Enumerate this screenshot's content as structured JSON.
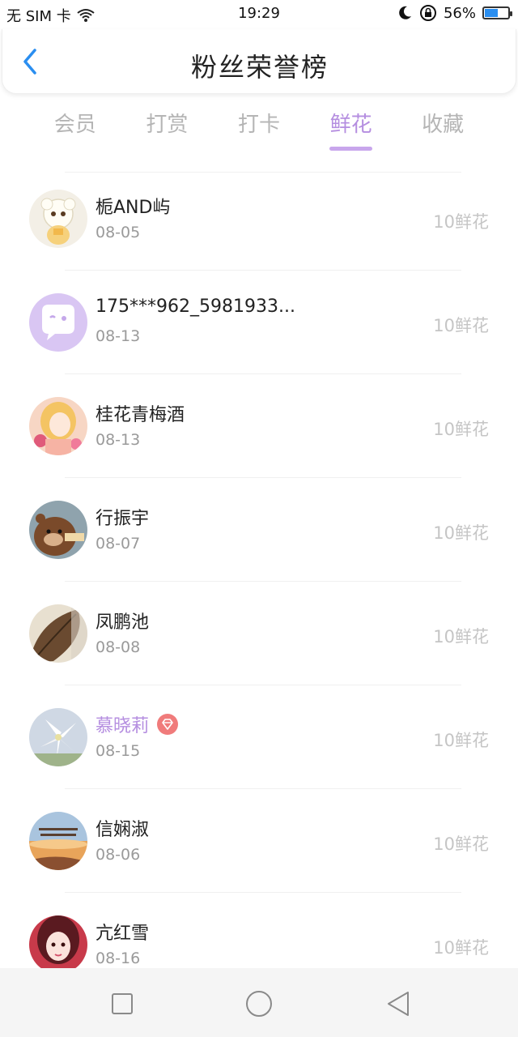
{
  "status": {
    "carrier": "无 SIM 卡",
    "time": "19:29",
    "battery_text": "56%",
    "battery_level": 0.56,
    "icons": [
      "wifi-icon",
      "moon-icon",
      "rotation-lock-icon",
      "battery-icon"
    ]
  },
  "header": {
    "title": "粉丝荣誉榜",
    "back_icon": "back-arrow-icon"
  },
  "tabs": [
    {
      "label": "会员",
      "active": false
    },
    {
      "label": "打赏",
      "active": false
    },
    {
      "label": "打卡",
      "active": false
    },
    {
      "label": "鲜花",
      "active": true
    },
    {
      "label": "收藏",
      "active": false
    }
  ],
  "fans": [
    {
      "name": "栀AND屿",
      "date": "08-05",
      "amount": "10鲜花",
      "vip": false,
      "avatar": "sheep-cartoon"
    },
    {
      "name": "175***962_5981933...",
      "date": "08-13",
      "amount": "10鲜花",
      "vip": false,
      "avatar": "default-chat-bubble"
    },
    {
      "name": "桂花青梅酒",
      "date": "08-13",
      "amount": "10鲜花",
      "vip": false,
      "avatar": "anime-girl"
    },
    {
      "name": "行振宇",
      "date": "08-07",
      "amount": "10鲜花",
      "vip": false,
      "avatar": "bear-cartoon"
    },
    {
      "name": "凤鹏池",
      "date": "08-08",
      "amount": "10鲜花",
      "vip": false,
      "avatar": "leaf-photo"
    },
    {
      "name": "慕晓莉",
      "date": "08-15",
      "amount": "10鲜花",
      "vip": true,
      "avatar": "lily-photo"
    },
    {
      "name": "信娴淑",
      "date": "08-06",
      "amount": "10鲜花",
      "vip": false,
      "avatar": "sunset-text-photo"
    },
    {
      "name": "亢红雪",
      "date": "08-16",
      "amount": "10鲜花",
      "vip": false,
      "avatar": "girl-photo"
    }
  ],
  "colors": {
    "accent": "#b58ee0",
    "tab_inactive": "#b5b5b5",
    "amount": "#c5c5c5",
    "date": "#9a9a9a",
    "vip_badge": "#f07b7b",
    "back_arrow": "#2a8ef0"
  },
  "navbar": {
    "buttons": [
      "recent-apps-icon",
      "home-icon",
      "back-triangle-icon"
    ]
  }
}
